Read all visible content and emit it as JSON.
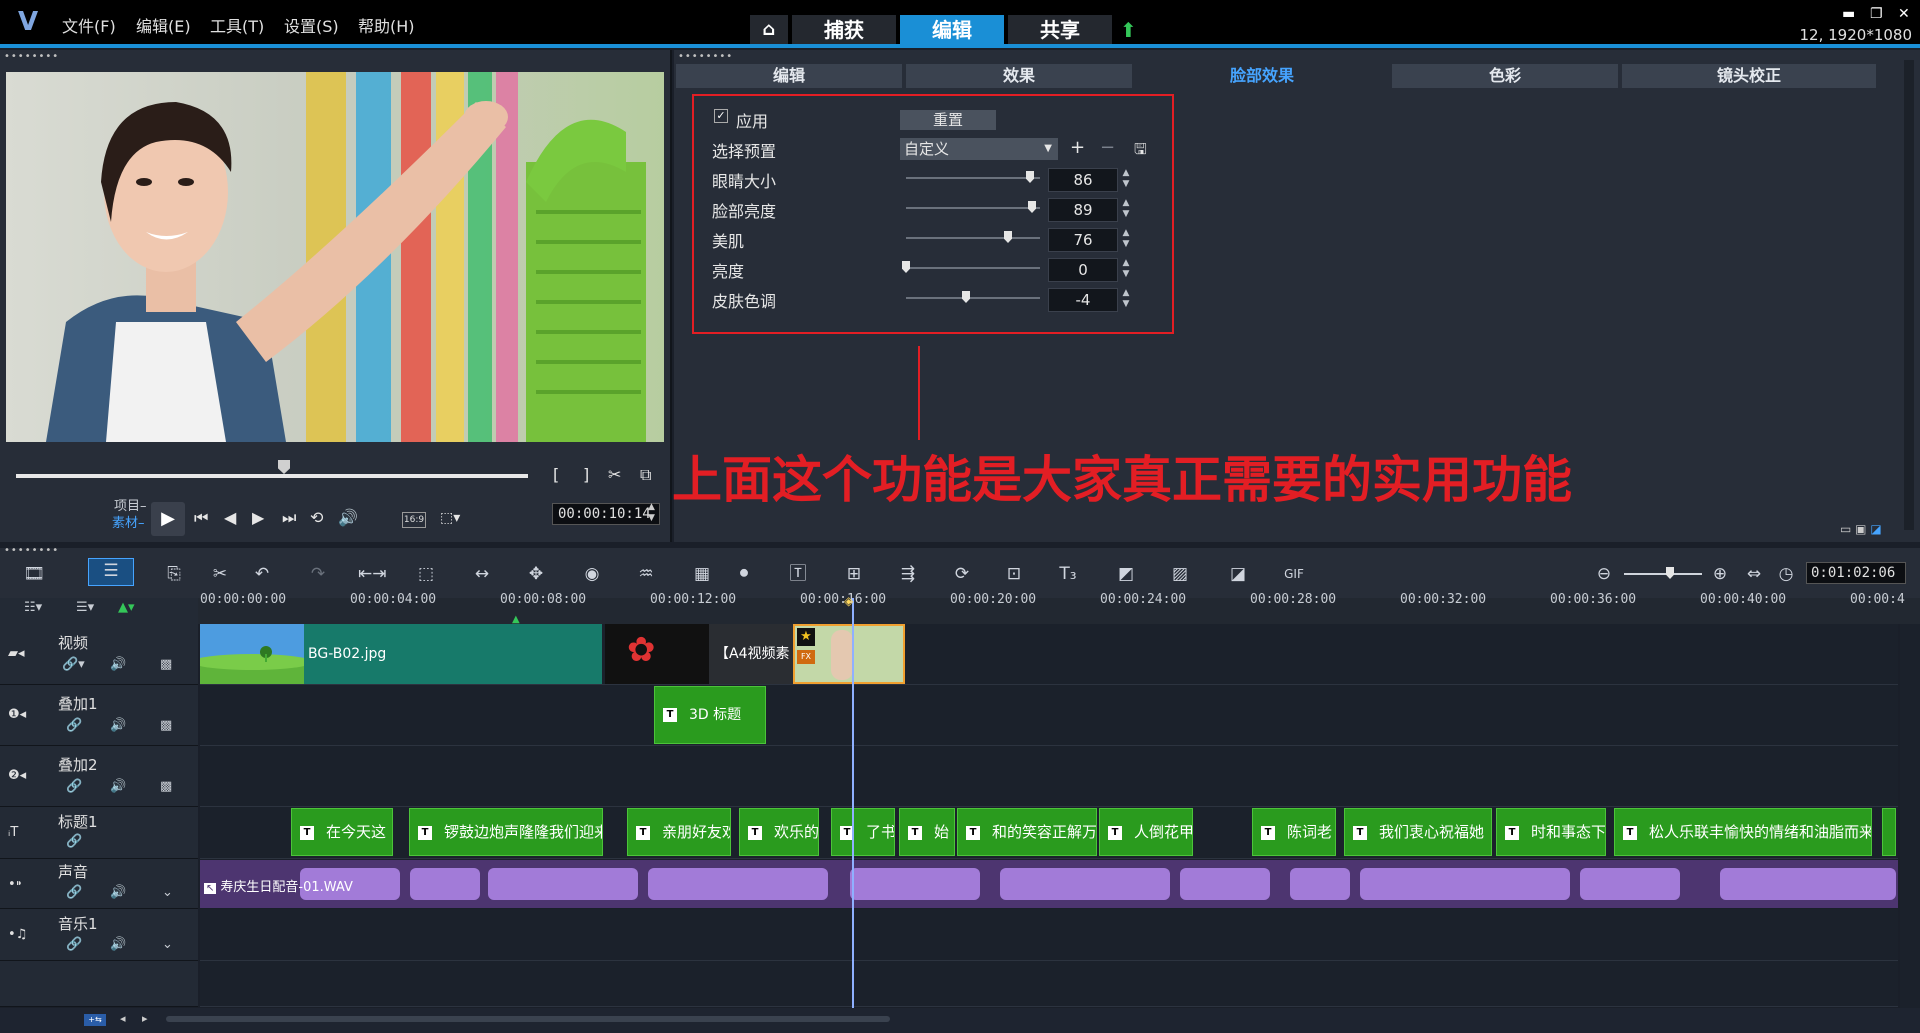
{
  "menu": {
    "items": [
      "文件(F)",
      "编辑(E)",
      "工具(T)",
      "设置(S)",
      "帮助(H)"
    ]
  },
  "nav": {
    "home": "⌂",
    "capture": "捕获",
    "edit": "编辑",
    "share": "共享"
  },
  "resolution": "12, 1920*1080",
  "preview": {
    "project_label": "项目–",
    "clip_label": "素材–",
    "timecode": "00:00:10:14",
    "aspect": "16:9"
  },
  "tabs": {
    "items": [
      "编辑",
      "效果",
      "脸部效果",
      "色彩",
      "镜头校正"
    ],
    "active": "脸部效果"
  },
  "face": {
    "apply_label": "应用",
    "apply_checked": true,
    "reset_label": "重置",
    "preset_label": "选择预置",
    "preset_value": "自定义",
    "sliders": [
      {
        "label": "眼睛大小",
        "value": "86"
      },
      {
        "label": "脸部亮度",
        "value": "89"
      },
      {
        "label": "美肌",
        "value": "76"
      },
      {
        "label": "亮度",
        "value": "0"
      },
      {
        "label": "皮肤色调",
        "value": "-4"
      }
    ]
  },
  "annotation": "上面这个功能是大家真正需要的实用功能",
  "timeline": {
    "zoom_timecode": "0:01:02:06",
    "ruler": [
      "00:00:00:00",
      "00:00:04:00",
      "00:00:08:00",
      "00:00:12:00",
      "00:00:16:00",
      "00:00:20:00",
      "00:00:24:00",
      "00:00:28:00",
      "00:00:32:00",
      "00:00:36:00",
      "00:00:40:00",
      "00:00:4"
    ],
    "tracks": [
      "视频",
      "叠加1",
      "叠加2",
      "标题1",
      "声音",
      "音乐1"
    ],
    "video_clips": [
      "BG-B02.jpg",
      "【A4视频素"
    ],
    "overlay_clip": "3D 标题",
    "title_clips": [
      "在今天这",
      "锣鼓边炮声隆隆我们迎来",
      "亲朋好友欢",
      "欢乐的",
      "了书",
      "始",
      "和的笑容正解万",
      "人倒花甲",
      "陈词老",
      "我们衷心祝福她",
      "时和事态下",
      "松人乐联丰愉快的情绪和油脂而来"
    ],
    "audio_clip": "寿庆生日配音-01.WAV"
  },
  "colors": {
    "accent": "#1a8fd6",
    "annotation": "#e31e24",
    "title_clip": "#2a9b1e",
    "audio": "#a27bd8"
  }
}
